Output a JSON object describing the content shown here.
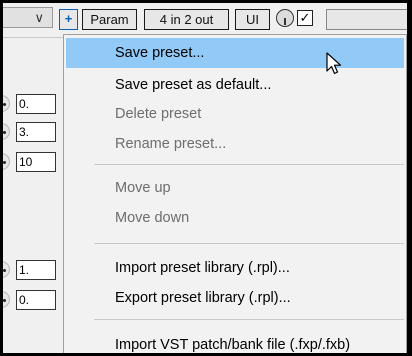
{
  "toolbar": {
    "dropdown_chevron": "∨",
    "add_button": "+",
    "param_button": "Param",
    "io_button": "4 in 2 out",
    "ui_button": "UI",
    "checkbox_mark": "✓"
  },
  "params": [
    {
      "value": "0."
    },
    {
      "value": "3."
    },
    {
      "value": "10"
    },
    {
      "value": "1."
    },
    {
      "value": "0."
    }
  ],
  "menu": {
    "items": [
      {
        "label": "Save preset...",
        "state": "highlighted"
      },
      {
        "label": "Save preset as default...",
        "state": "enabled"
      },
      {
        "label": "Delete preset",
        "state": "disabled"
      },
      {
        "label": "Rename preset...",
        "state": "disabled"
      },
      {
        "label": "Move up",
        "state": "disabled"
      },
      {
        "label": "Move down",
        "state": "disabled"
      },
      {
        "label": "Import preset library (.rpl)...",
        "state": "enabled"
      },
      {
        "label": "Export preset library (.rpl)...",
        "state": "enabled"
      },
      {
        "label": "Import VST patch/bank file (.fxp/.fxb)",
        "state": "enabled"
      }
    ]
  },
  "colors": {
    "highlight": "#91c9f7",
    "disabled_text": "#6d6d6d",
    "frame": "#000000"
  },
  "icons": [
    "chevron-down-icon",
    "plus-icon",
    "knob-icon",
    "checkbox-icon",
    "mouse-pointer-icon"
  ]
}
